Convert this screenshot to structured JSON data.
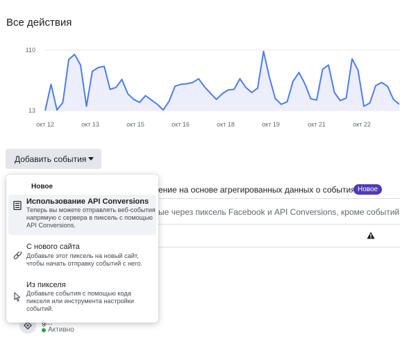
{
  "page": {
    "title": "Все действия"
  },
  "chart_data": {
    "type": "area",
    "ylim": [
      13,
      110
    ],
    "y_tick_labels": [
      "110",
      "13"
    ],
    "x_tick_labels": [
      "окт 12",
      "окт 13",
      "окт 15",
      "окт 16",
      "окт 18",
      "окт 19",
      "окт 21",
      "окт 22"
    ],
    "series": [
      {
        "values": [
          13,
          55,
          14,
          26,
          95,
          103,
          86,
          20,
          76,
          82,
          84,
          47,
          50,
          63,
          40,
          31,
          26,
          37,
          30,
          23,
          14,
          28,
          52,
          55,
          56,
          58,
          64,
          51,
          41,
          31,
          40,
          46,
          47,
          64,
          50,
          42,
          49,
          108,
          66,
          32,
          23,
          27,
          60,
          74,
          56,
          32,
          30,
          79,
          86,
          42,
          29,
          33,
          96,
          78,
          20,
          25,
          53,
          58,
          52,
          31,
          23
        ],
        "color": "#4c7de7",
        "fill": "#eceefb"
      }
    ],
    "grid": true
  },
  "toolbar": {
    "add_events_label": "Добавить события"
  },
  "background": {
    "row1_text": "ение на основе агрегированных данных о событиях",
    "row1_badge": "Новое",
    "row2_text": "ые через пиксель Facebook и API Conversions, кроме событий, связа",
    "warning_icon": "warning-icon"
  },
  "pixel_status": {
    "name": "g...",
    "status": "Активно",
    "status_color": "#31a24c"
  },
  "menu": {
    "header": "Новое",
    "items": [
      {
        "icon": "server-icon",
        "title": "Использование API Conversions",
        "description": "Теперь вы можете отправлять веб-события напрямую с сервера в пиксель с помощью API Conversions."
      },
      {
        "icon": "link-icon",
        "title": "С нового сайта",
        "description": "Добавьте этот пиксель на новый сайт, чтобы начать отправку событий с него."
      },
      {
        "icon": "cursor-click-icon",
        "title": "Из пикселя",
        "description": "Добавьте события с помощью кода пикселя или инструмента настройки событий."
      }
    ]
  },
  "colors": {
    "accent": "#4c7de7",
    "badge": "#4f3bb5"
  }
}
